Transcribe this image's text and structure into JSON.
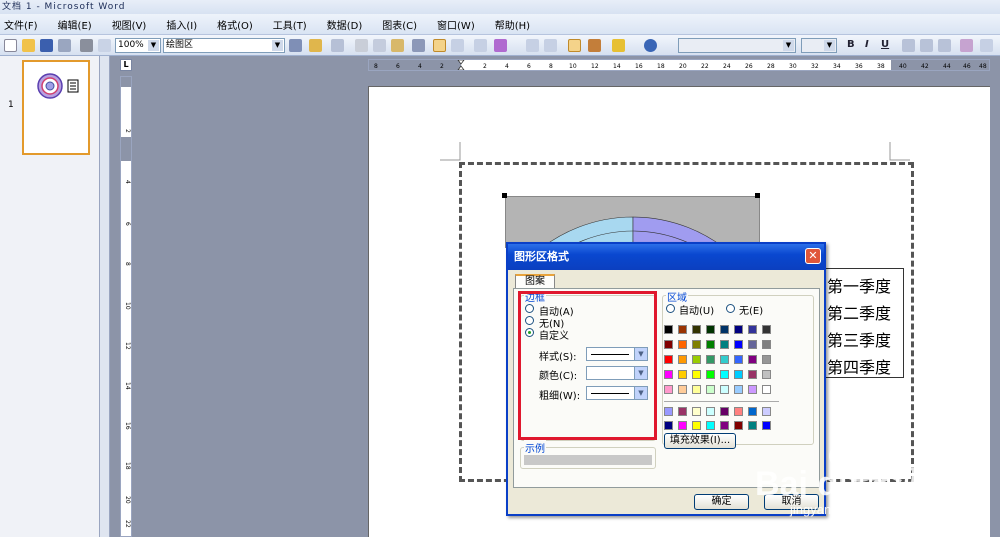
{
  "window": {
    "title": "文档 1 - Microsoft Word"
  },
  "menu": [
    "文件(F)",
    "编辑(E)",
    "视图(V)",
    "插入(I)",
    "格式(O)",
    "工具(T)",
    "数据(D)",
    "图表(C)",
    "窗口(W)",
    "帮助(H)"
  ],
  "toolbar": {
    "zoom": "100%",
    "object_select": "绘图区",
    "bold": "B",
    "italic": "I",
    "underline": "U"
  },
  "thumbnail": {
    "page_number": "1"
  },
  "ruler": {
    "h_labels": [
      "8",
      "6",
      "4",
      "2",
      "2",
      "4",
      "6",
      "8",
      "10",
      "12",
      "14",
      "16",
      "18",
      "20",
      "22",
      "24",
      "26",
      "28",
      "30",
      "32",
      "34",
      "36",
      "38",
      "40",
      "42",
      "44",
      "46",
      "48"
    ],
    "v_labels": [
      "2",
      "4",
      "6",
      "8",
      "10",
      "12",
      "14",
      "16",
      "18",
      "20",
      "22"
    ],
    "corner": "L"
  },
  "legend": [
    "第一季度",
    "第二季度",
    "第三季度",
    "第四季度"
  ],
  "dialog": {
    "title": "图形区格式",
    "tab": "图案",
    "border_group": "边框",
    "border_auto": "自动(A)",
    "border_none": "无(N)",
    "border_custom": "自定义",
    "style_label": "样式(S):",
    "color_label": "颜色(C):",
    "weight_label": "粗细(W):",
    "area_group": "区域",
    "area_auto": "自动(U)",
    "area_none": "无(E)",
    "fill_effects": "填充效果(I)...",
    "sample_label": "示例",
    "ok": "确定",
    "cancel": "取消"
  },
  "palette": {
    "row1": [
      "#000000",
      "#993300",
      "#333300",
      "#003300",
      "#003366",
      "#000080",
      "#333399",
      "#333333"
    ],
    "row2": [
      "#800000",
      "#ff6600",
      "#808000",
      "#008000",
      "#008080",
      "#0000ff",
      "#666699",
      "#808080"
    ],
    "row3": [
      "#ff0000",
      "#ff9900",
      "#99cc00",
      "#339966",
      "#33cccc",
      "#3366ff",
      "#800080",
      "#969696"
    ],
    "row4": [
      "#ff00ff",
      "#ffcc00",
      "#ffff00",
      "#00ff00",
      "#00ffff",
      "#00ccff",
      "#993366",
      "#c0c0c0"
    ],
    "row5": [
      "#ff99cc",
      "#ffcc99",
      "#ffff99",
      "#ccffcc",
      "#ccffff",
      "#99ccff",
      "#cc99ff",
      "#ffffff"
    ],
    "row6": [
      "#9999ff",
      "#993366",
      "#ffffcc",
      "#ccffff",
      "#660066",
      "#ff8080",
      "#0066cc",
      "#ccccff"
    ],
    "row7": [
      "#000080",
      "#ff00ff",
      "#ffff00",
      "#00ffff",
      "#800080",
      "#800000",
      "#008080",
      "#0000ff"
    ]
  },
  "watermark": {
    "text": "Bai du 经验",
    "url": "jingyan.baidu.com"
  }
}
